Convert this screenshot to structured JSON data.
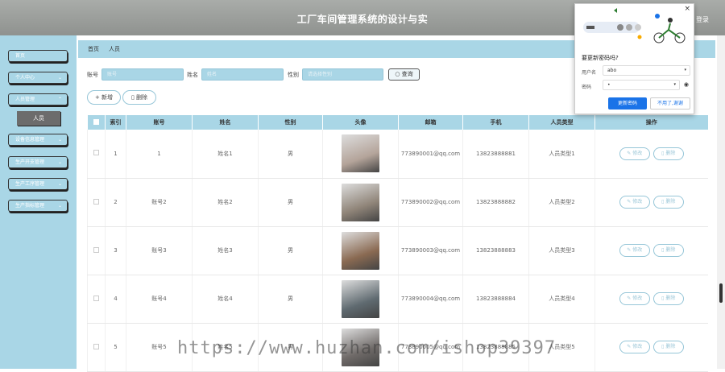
{
  "app_title": "工厂车间管理系统的设计与实",
  "logout_label": "登录",
  "sidebar": {
    "items": [
      {
        "label": "首页",
        "has_chevron": false
      },
      {
        "label": "个人中心",
        "has_chevron": true
      },
      {
        "label": "人员管理",
        "has_chevron": true
      },
      {
        "label": "设备信息管理",
        "has_chevron": true
      },
      {
        "label": "生产开支管理",
        "has_chevron": true
      },
      {
        "label": "生产工序管理",
        "has_chevron": true
      },
      {
        "label": "生产指标管理",
        "has_chevron": true
      }
    ],
    "active_sub": "人员"
  },
  "breadcrumb": {
    "home": "首页",
    "current": "人员"
  },
  "search": {
    "account_label": "账号",
    "account_placeholder": "账号",
    "name_label": "姓名",
    "name_placeholder": "姓名",
    "gender_label": "性别",
    "gender_placeholder": "请选择性别",
    "query_label": "查询"
  },
  "actions": {
    "add_label": "新增",
    "delete_label": "删除"
  },
  "table": {
    "headers": [
      "",
      "索引",
      "账号",
      "姓名",
      "性别",
      "头像",
      "邮箱",
      "手机",
      "人员类型",
      "操作"
    ],
    "rows": [
      {
        "index": "1",
        "account": "1",
        "name": "姓名1",
        "gender": "男",
        "email": "773890001@qq.com",
        "phone": "13823888881",
        "type": "人员类型1",
        "avatar_color": "#b4a49a"
      },
      {
        "index": "2",
        "account": "账号2",
        "name": "姓名2",
        "gender": "男",
        "email": "773890002@qq.com",
        "phone": "13823888882",
        "type": "人员类型2",
        "avatar_color": "#8f8478"
      },
      {
        "index": "3",
        "account": "账号3",
        "name": "姓名3",
        "gender": "男",
        "email": "773890003@qq.com",
        "phone": "13823888883",
        "type": "人员类型3",
        "avatar_color": "#8a6a52"
      },
      {
        "index": "4",
        "account": "账号4",
        "name": "姓名4",
        "gender": "男",
        "email": "773890004@qq.com",
        "phone": "13823888884",
        "type": "人员类型4",
        "avatar_color": "#5f6a70"
      },
      {
        "index": "5",
        "account": "账号5",
        "name": "姓名5",
        "gender": "男",
        "email": "773890005@qq.com",
        "phone": "13823888885",
        "type": "人员类型5",
        "avatar_color": "#6f6a68"
      }
    ],
    "edit_label": "修改",
    "row_delete_label": "删除"
  },
  "password_popup": {
    "question": "要更新密码吗?",
    "username_label": "用户名",
    "username_value": "abo",
    "password_label": "密码",
    "password_value": "•",
    "update_label": "更新密码",
    "decline_label": "不用了,谢谢"
  },
  "watermark": "https://www.huzhan.com/ishop39397",
  "colors": {
    "accent": "#a9d6e6",
    "header": "#999c99",
    "primary_blue": "#1a73e8"
  }
}
